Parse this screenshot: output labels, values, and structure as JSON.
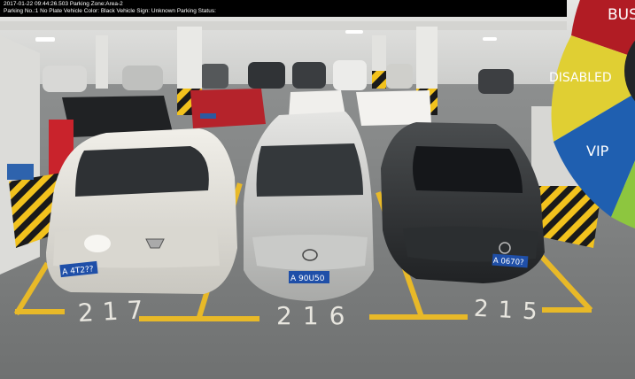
{
  "camera_overlay": {
    "line1": "2017-01-22 09:44:26.503  Parking Zone:Area-2",
    "line2": "Parking No.:1 No Plate Vehicle Color: Black Vehicle Sign: Unknown Parking Status:"
  },
  "parking_slots": [
    {
      "number": "217",
      "plate": "A 4T2??",
      "car_color": "white"
    },
    {
      "number": "216",
      "plate": "A 90U50",
      "car_color": "silver"
    },
    {
      "number": "215",
      "plate": "A 0670?",
      "car_color": "black"
    }
  ],
  "category_wheel": {
    "segments": [
      {
        "label": "BUS",
        "color": "#b11c24"
      },
      {
        "label": "DISABLED",
        "color": "#e0cf33"
      },
      {
        "label": "VIP",
        "color": "#1f5fb0"
      },
      {
        "label": "",
        "color": "#8dc63f"
      }
    ]
  },
  "colors": {
    "floor": "#7d7f80",
    "lane_paint": "#e8b928",
    "hazard_yellow": "#f2c21d",
    "hazard_black": "#1a1a1a"
  }
}
